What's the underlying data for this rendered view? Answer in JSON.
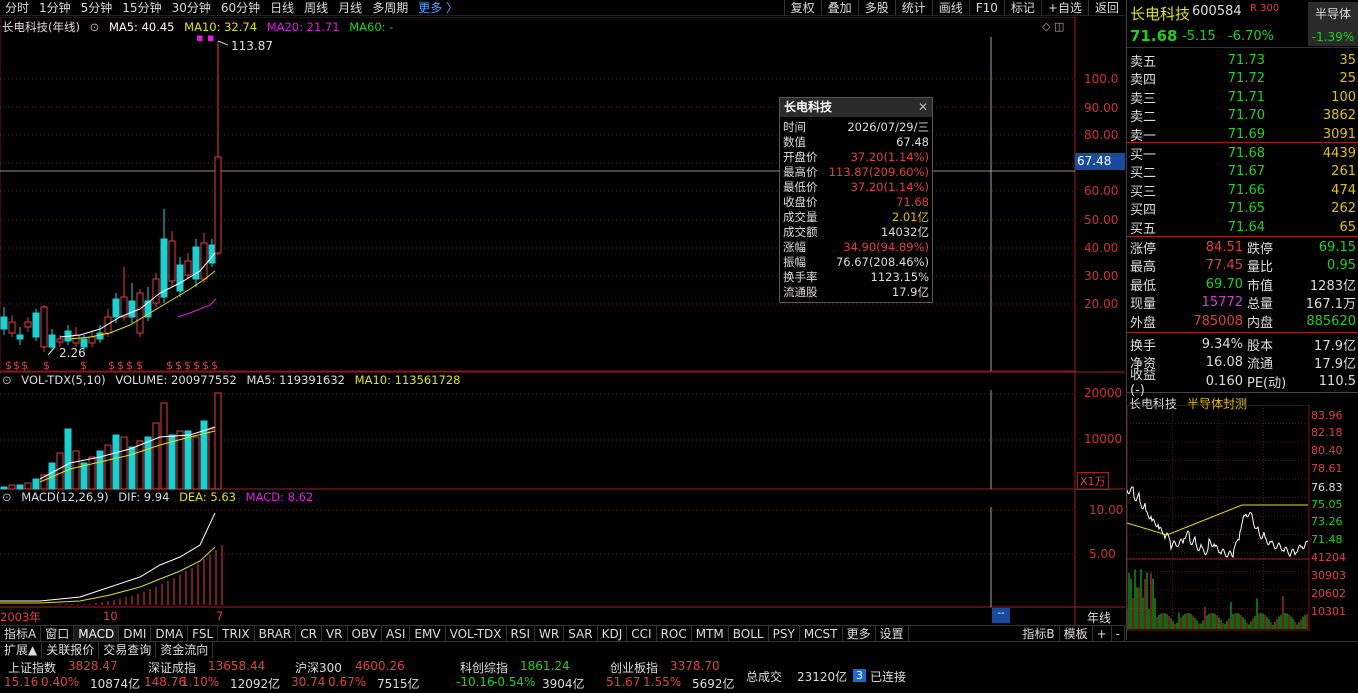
{
  "toolbar": {
    "periods": [
      "分时",
      "1分钟",
      "5分钟",
      "15分钟",
      "30分钟",
      "60分钟",
      "日线",
      "周线",
      "月线",
      "多周期",
      "更多 〉"
    ],
    "right": [
      "复权",
      "叠加",
      "多股",
      "统计",
      "画线",
      "F10",
      "标记",
      "+自选",
      "返回"
    ]
  },
  "main_legend": {
    "name": "长电科技(年线)",
    "ma5": "MA5: 40.45",
    "ma10": "MA10: 32.74",
    "ma20": "MA20: 21.71",
    "ma60": "MA60: -"
  },
  "price_axis": [
    "100.0",
    "90.00",
    "80.00",
    "70.00",
    "60.00",
    "50.00",
    "40.00",
    "30.00",
    "20.00"
  ],
  "crosshair_price": "67.48",
  "high_label": "113.87",
  "low_label": "2.26",
  "vol_legend": {
    "name": "VOL-TDX(5,10)",
    "volume": "VOLUME: 200977552",
    "ma5": "MA5: 119391632",
    "ma10": "MA10: 113561728"
  },
  "vol_axis": [
    "20000",
    "10000"
  ],
  "vol_unit": "X1万",
  "macd_legend": {
    "name": "MACD(12,26,9)",
    "dif": "DIF: 9.94",
    "dea": "DEA: 5.63",
    "macd": "MACD: 8.62"
  },
  "macd_axis": [
    "10.00",
    "5.00"
  ],
  "xaxis": [
    "2003年",
    "10",
    "7"
  ],
  "period_label": "年线",
  "tooltip": {
    "title": "长电科技",
    "rows": [
      {
        "k": "时间",
        "v": "2026/07/29/三",
        "color": "#dddddd"
      },
      {
        "k": "数值",
        "v": "67.48",
        "color": "#dddddd"
      },
      {
        "k": "开盘价",
        "v": "37.20(1.14%)",
        "color": "#e04040"
      },
      {
        "k": "最高价",
        "v": "113.87(209.60%)",
        "color": "#e04040"
      },
      {
        "k": "最低价",
        "v": "37.20(1.14%)",
        "color": "#e04040"
      },
      {
        "k": "收盘价",
        "v": "71.68",
        "color": "#e04040"
      },
      {
        "k": "成交量",
        "v": "2.01亿",
        "color": "#e0c020"
      },
      {
        "k": "成交额",
        "v": "14032亿",
        "color": "#dddddd"
      },
      {
        "k": "涨幅",
        "v": "34.90(94.89%)",
        "color": "#e04040"
      },
      {
        "k": "振幅",
        "v": "76.67(208.46%)",
        "color": "#dddddd"
      },
      {
        "k": "换手率",
        "v": "1123.15%",
        "color": "#dddddd"
      },
      {
        "k": "流通股",
        "v": "17.9亿",
        "color": "#dddddd"
      }
    ]
  },
  "bottom_tabs": [
    "指标A",
    "窗口",
    "MACD",
    "DMI",
    "DMA",
    "FSL",
    "TRIX",
    "BRAR",
    "CR",
    "VR",
    "OBV",
    "ASI",
    "EMV",
    "VOL-TDX",
    "RSI",
    "WR",
    "SAR",
    "KDJ",
    "CCI",
    "ROC",
    "MTM",
    "BOLL",
    "PSY",
    "MCST",
    "更多",
    "设置"
  ],
  "bottom_tabs_right": [
    "指标B",
    "模板",
    "+",
    "-"
  ],
  "bottom_tabs2": [
    "扩展▲",
    "关联报价",
    "交易查询",
    "资金流向"
  ],
  "stock": {
    "name": "长电科技",
    "code": "600584",
    "badge": "R 300",
    "sector": "半导体",
    "sector_change": "-1.39%",
    "price": "71.68",
    "change": "-5.15",
    "change_pct": "-6.70%"
  },
  "asks": [
    {
      "label": "卖五",
      "price": "71.73",
      "vol": "35"
    },
    {
      "label": "卖四",
      "price": "71.72",
      "vol": "25"
    },
    {
      "label": "卖三",
      "price": "71.71",
      "vol": "100"
    },
    {
      "label": "卖二",
      "price": "71.70",
      "vol": "3862"
    },
    {
      "label": "卖一",
      "price": "71.69",
      "vol": "3091"
    }
  ],
  "bids": [
    {
      "label": "买一",
      "price": "71.68",
      "vol": "4439"
    },
    {
      "label": "买二",
      "price": "71.67",
      "vol": "261"
    },
    {
      "label": "买三",
      "price": "71.66",
      "vol": "474"
    },
    {
      "label": "买四",
      "price": "71.65",
      "vol": "262"
    },
    {
      "label": "买五",
      "price": "71.64",
      "vol": "65"
    }
  ],
  "stats1": [
    {
      "k1": "涨停",
      "v1": "84.51",
      "c1": "#e04040",
      "k2": "跌停",
      "v2": "69.15",
      "c2": "#20d020"
    },
    {
      "k1": "最高",
      "v1": "77.45",
      "c1": "#e04040",
      "k2": "量比",
      "v2": "0.95",
      "c2": "#20d020"
    },
    {
      "k1": "最低",
      "v1": "69.70",
      "c1": "#20d020",
      "k2": "市值",
      "v2": "1283亿",
      "c2": "#dddddd"
    },
    {
      "k1": "现量",
      "v1": "15772",
      "c1": "#d040d0",
      "k2": "总量",
      "v2": "167.1万",
      "c2": "#dddddd"
    },
    {
      "k1": "外盘",
      "v1": "785008",
      "c1": "#e04040",
      "k2": "内盘",
      "v2": "885620",
      "c2": "#20d020"
    }
  ],
  "stats2": [
    {
      "k1": "换手",
      "v1": "9.34%",
      "c1": "#dddddd",
      "k2": "股本",
      "v2": "17.9亿",
      "c2": "#dddddd"
    },
    {
      "k1": "净资",
      "v1": "16.08",
      "c1": "#dddddd",
      "k2": "流通",
      "v2": "17.9亿",
      "c2": "#dddddd"
    },
    {
      "k1": "收益(-)",
      "v1": "0.160",
      "c1": "#dddddd",
      "k2": "PE(动)",
      "v2": "110.5",
      "c2": "#dddddd"
    }
  ],
  "mini": {
    "name": "长电科技",
    "tag": "半导体封测",
    "price_axis": [
      "83.96",
      "82.18",
      "80.40",
      "78.61",
      "76.83",
      "75.05",
      "73.26",
      "71.48"
    ],
    "vol_axis": [
      "41204",
      "30903",
      "20602",
      "10301"
    ]
  },
  "ticker": [
    {
      "name": "上证指数",
      "value": "3828.47",
      "chg": "15.16",
      "pct": "0.40%",
      "amt": "10874亿"
    },
    {
      "name": "深证成指",
      "value": "13658.44",
      "chg": "148.76",
      "pct": "1.10%",
      "amt": "12092亿"
    },
    {
      "name": "沪深300",
      "value": "4600.26",
      "chg": "30.74",
      "pct": "0.67%",
      "amt": "7515亿"
    },
    {
      "name": "科创综指",
      "value": "1861.24",
      "chg": "-10.16",
      "pct": "-0.54%",
      "amt": "3904亿"
    },
    {
      "name": "创业板指",
      "value": "3378.70",
      "chg": "51.67",
      "pct": "1.55%",
      "amt": "5692亿"
    }
  ],
  "total_label": "总成交",
  "total_value": "23120亿",
  "conn_count": "3",
  "conn_label": "已连接",
  "colors": {
    "up": "#e04040",
    "down": "#20d0d0",
    "grid": "#7a1515",
    "ma5": "#ffffff",
    "ma10": "#e0e020",
    "ma20": "#e020e0"
  }
}
